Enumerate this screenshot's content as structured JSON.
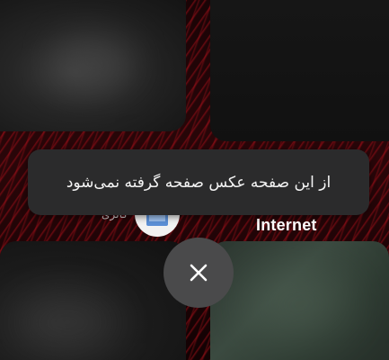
{
  "toast": {
    "message": "از این صفحه عکس صفحه گرفته نمی‌شود"
  },
  "recent_apps": [
    {
      "label": "گالری",
      "icon": "gallery-icon"
    },
    {
      "label": "Internet",
      "icon": "browser-icon"
    }
  ],
  "controls": {
    "close_icon": "close-icon"
  },
  "colors": {
    "toast_background": "#2b2b2c",
    "close_button_background": "#4a4a4b",
    "wallpaper_accent": "#a0101c"
  }
}
